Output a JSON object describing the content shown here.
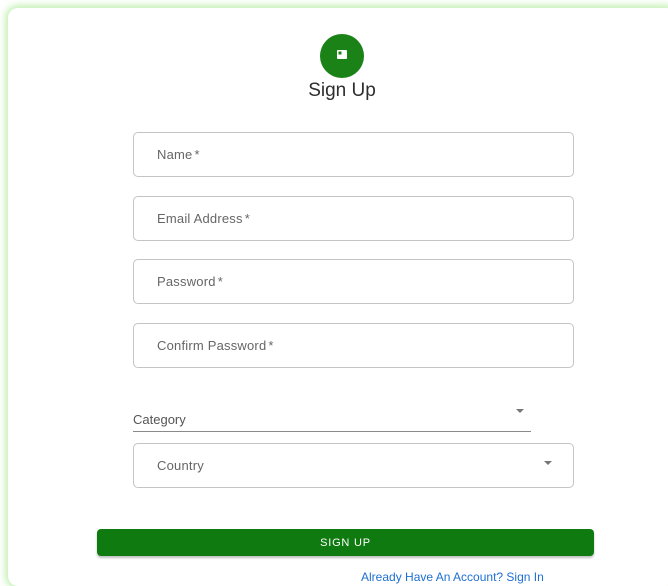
{
  "header": {
    "title": "Sign Up",
    "icon": "lock-icon"
  },
  "form": {
    "name_label": "Name",
    "email_label": "Email Address",
    "password_label": "Password",
    "confirm_password_label": "Confirm Password",
    "required_mark": "*",
    "category_label": "Category",
    "country_label": "Country"
  },
  "actions": {
    "signup_label": "SIGN UP",
    "signin_link": "Already Have An Account? Sign In"
  },
  "colors": {
    "accent": "#0f7a0f",
    "avatar": "#1a8217",
    "link": "#1f6fd1",
    "card_glow": "#96e678"
  }
}
